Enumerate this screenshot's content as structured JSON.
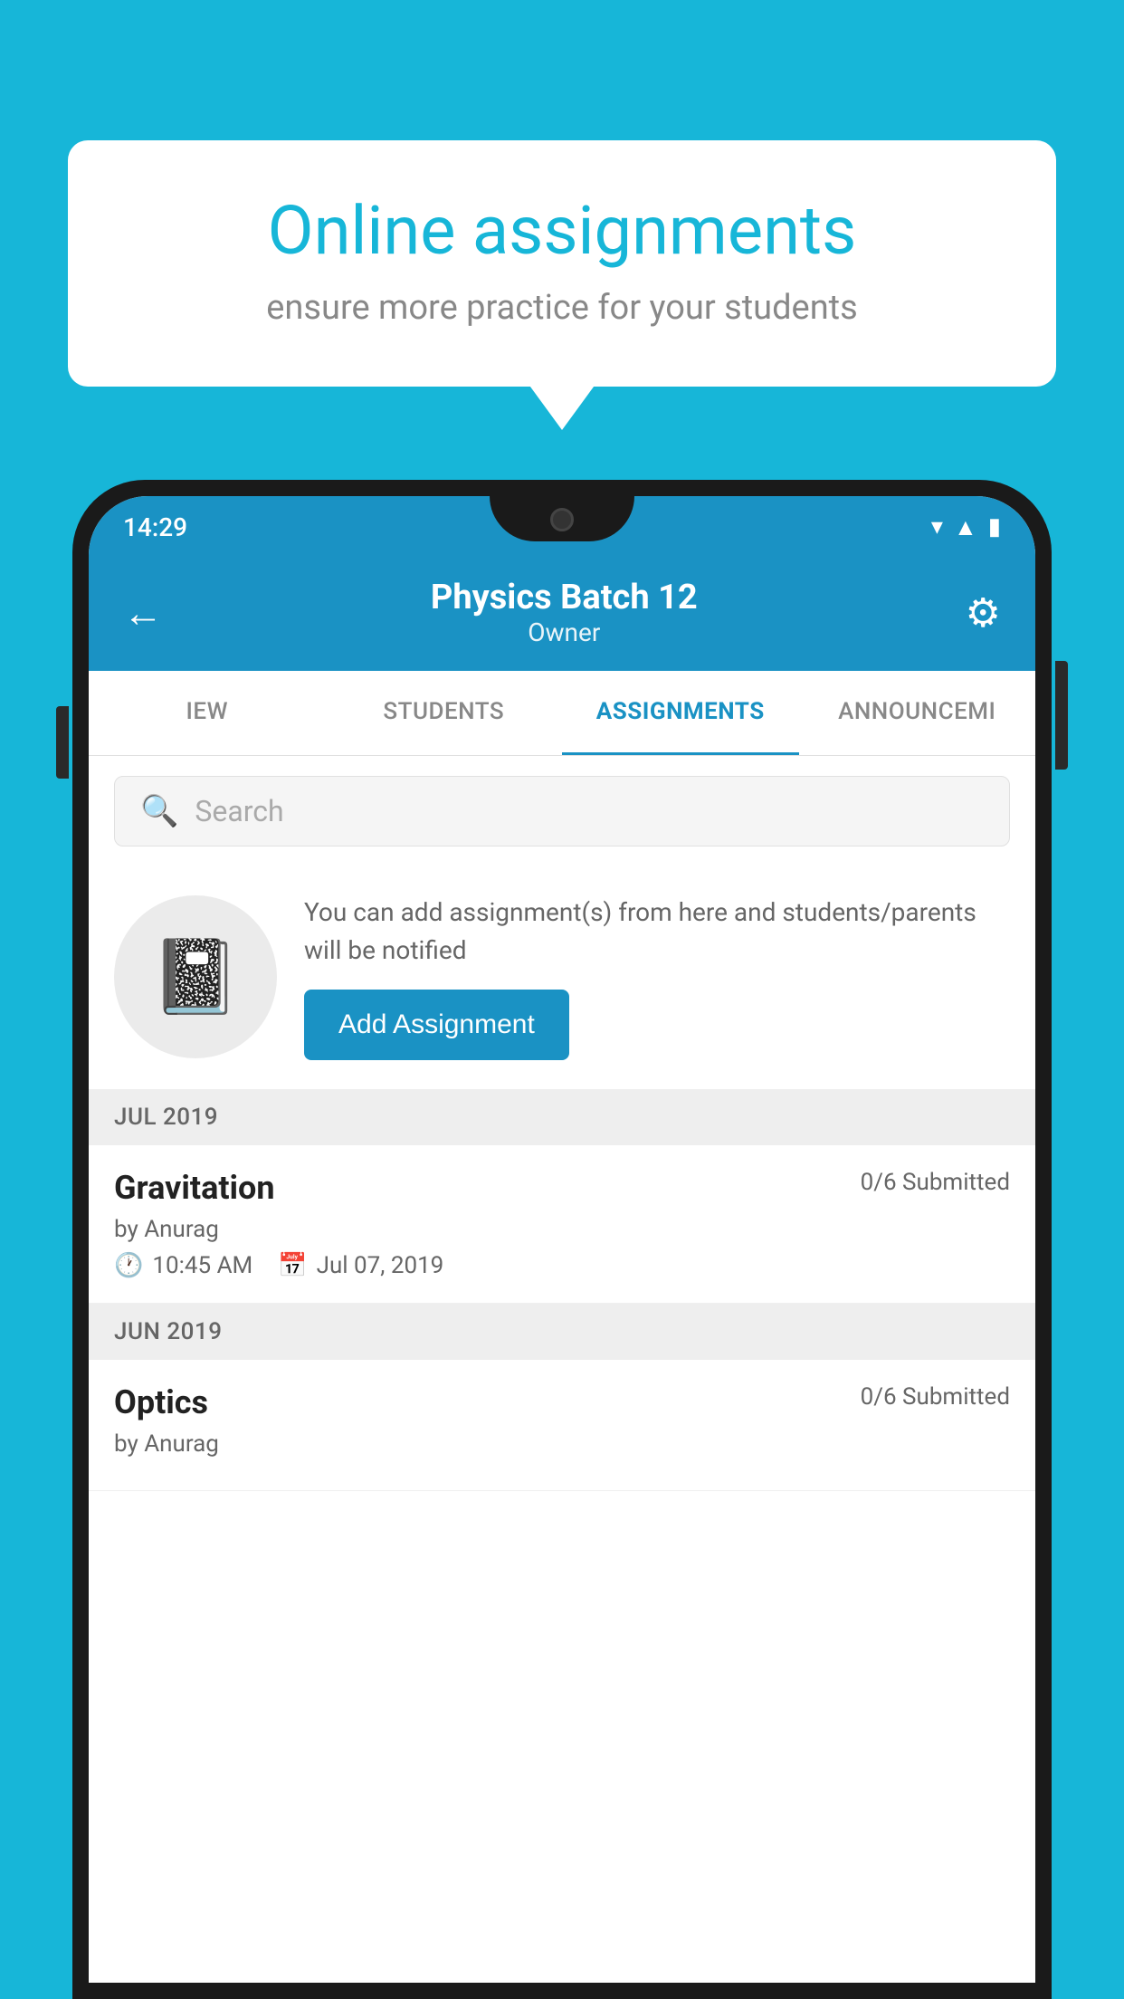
{
  "background": {
    "color": "#17b6d8"
  },
  "speech_bubble": {
    "title": "Online assignments",
    "subtitle": "ensure more practice for your students"
  },
  "phone": {
    "status_bar": {
      "time": "14:29"
    },
    "header": {
      "title": "Physics Batch 12",
      "subtitle": "Owner"
    },
    "tabs": [
      {
        "label": "IEW",
        "active": false
      },
      {
        "label": "STUDENTS",
        "active": false
      },
      {
        "label": "ASSIGNMENTS",
        "active": true
      },
      {
        "label": "ANNOUNCEM",
        "active": false
      }
    ],
    "search": {
      "placeholder": "Search"
    },
    "add_assignment": {
      "description": "You can add assignment(s) from here and students/parents will be notified",
      "button_label": "Add Assignment"
    },
    "sections": [
      {
        "label": "JUL 2019",
        "items": [
          {
            "name": "Gravitation",
            "submitted": "0/6 Submitted",
            "by": "by Anurag",
            "time": "10:45 AM",
            "date": "Jul 07, 2019"
          }
        ]
      },
      {
        "label": "JUN 2019",
        "items": [
          {
            "name": "Optics",
            "submitted": "0/6 Submitted",
            "by": "by Anurag",
            "time": "",
            "date": ""
          }
        ]
      }
    ]
  }
}
